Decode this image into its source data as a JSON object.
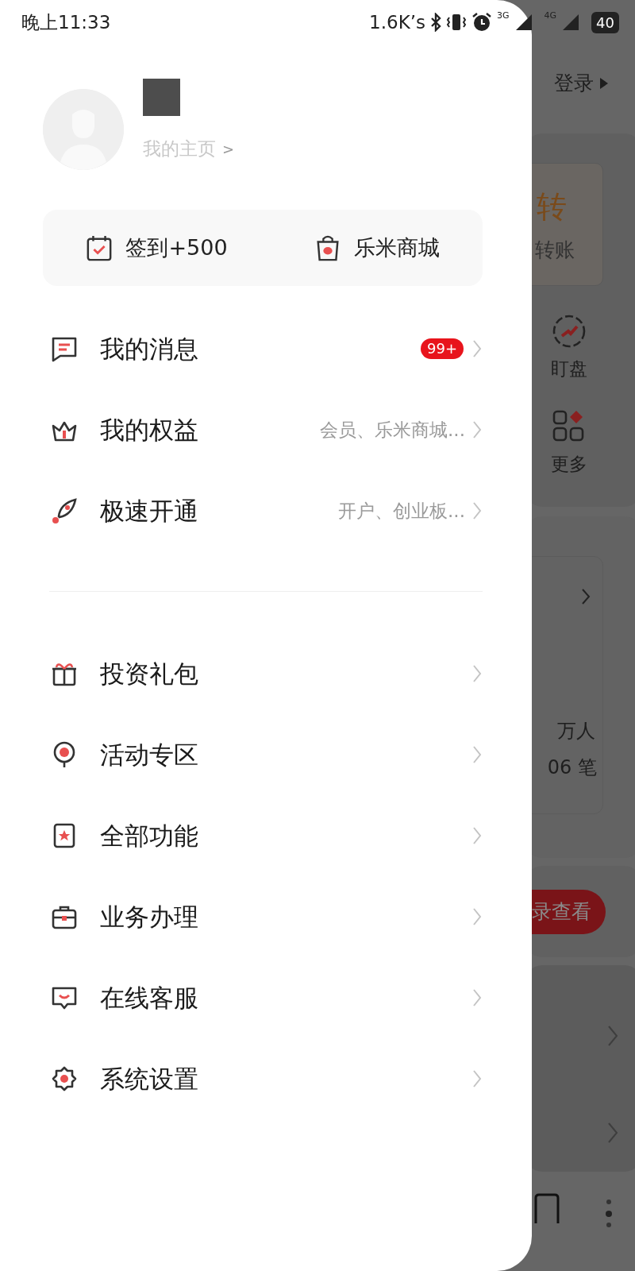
{
  "status_bar": {
    "time": "晚上11:33",
    "net_speed": "1.6K’s",
    "network_1": "3G",
    "network_2": "4G",
    "battery": "40"
  },
  "profile": {
    "home_link": "我的主页",
    "home_arrow": ">"
  },
  "quick_actions": [
    {
      "kind": "checkin",
      "label": "签到+500"
    },
    {
      "kind": "mall",
      "label": "乐米商城"
    }
  ],
  "menu_groups": [
    [
      {
        "kind": "message",
        "label": "我的消息",
        "badge": "99+"
      },
      {
        "kind": "crown",
        "label": "我的权益",
        "hint": "会员、乐米商城..."
      },
      {
        "kind": "rocket",
        "label": "极速开通",
        "hint": "开户、创业板..."
      }
    ],
    [
      {
        "kind": "gift",
        "label": "投资礼包"
      },
      {
        "kind": "pin",
        "label": "活动专区"
      },
      {
        "kind": "star",
        "label": "全部功能"
      },
      {
        "kind": "briefcase",
        "label": "业务办理"
      },
      {
        "kind": "chat",
        "label": "在线客服"
      },
      {
        "kind": "gear",
        "label": "系统设置"
      }
    ]
  ],
  "background_page": {
    "login_link": "登录",
    "transfer_title": "转",
    "transfer_subtitle": "转账",
    "shortcuts": [
      {
        "kind": "watch",
        "label": "盯盘"
      },
      {
        "kind": "more",
        "label": "更多"
      }
    ],
    "stats": [
      "万人",
      "06 笔"
    ],
    "action_button": "录查看"
  }
}
